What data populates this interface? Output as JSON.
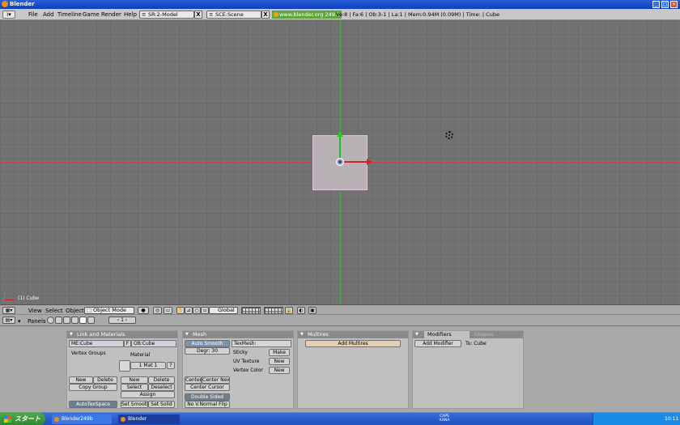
{
  "window": {
    "title": "Blender",
    "controls": [
      "minimize-icon",
      "maximize-icon",
      "close-icon"
    ]
  },
  "info_header": {
    "menus": [
      "File",
      "Add",
      "Timeline",
      "Game",
      "Render",
      "Help"
    ],
    "screen_field": "SR:2-Model",
    "scene_field": "SCE:Scene",
    "close_label": "X",
    "website": "www.blender.org 249.2",
    "stats": "Ve:8 | Fa:6 | Ob:3-1 | La:1  | Mem:0.94M (0.09M)  | Time: | Cube"
  },
  "viewport": {
    "object_label": "(1) Cube"
  },
  "view_header": {
    "menus": [
      "View",
      "Select",
      "Object"
    ],
    "mode": "Object Mode",
    "orientation": "Global"
  },
  "buttons_header": {
    "panels_label": "Panels",
    "frame": "1"
  },
  "panels": {
    "link_materials": {
      "title": "Link and Materials",
      "mesh_name": "ME:Cube",
      "f_label": "F",
      "object_name": "OB:Cube",
      "vertex_groups": "Vertex Groups",
      "material": "Material",
      "mat_index": "1 Mat 1",
      "mat_q": "?",
      "new": "New",
      "delete": "Delete",
      "copy_group": "Copy Group",
      "mat_new": "New",
      "mat_delete": "Delete",
      "select": "Select",
      "deselect": "Deselect",
      "assign": "Assign",
      "autotexspace": "AutoTexSpace",
      "set_smooth": "Set Smooth",
      "set_solid": "Set Solid"
    },
    "mesh": {
      "title": "Mesh",
      "auto_smooth": "Auto Smooth",
      "degr": "Degr: 30",
      "texmesh": "TexMesh:",
      "sticky": "Sticky",
      "make": "Make",
      "uv_texture": "UV Texture",
      "uv_new": "New",
      "vertex_color": "Vertex Color",
      "vc_new": "New",
      "center": "Center",
      "center_new": "Center New",
      "center_cursor": "Center Cursor",
      "double_sided": "Double Sided",
      "no_v_normal_flip": "No V.Normal Flip"
    },
    "multires": {
      "title": "Multires",
      "add_multires": "Add Multires"
    },
    "modifiers": {
      "tab_modifiers": "Modifiers",
      "tab_shapes": "Shapes",
      "add_modifier": "Add Modifier",
      "to_cube": "To: Cube"
    }
  },
  "taskbar": {
    "start": "スタート",
    "tasks": [
      "Blender249b",
      "Blender"
    ],
    "tray_caps": "CAPS",
    "tray_kana": "KANA",
    "clock": "10:11"
  },
  "colors": {
    "viewport_bg": "#727272",
    "panel_bg": "#c0c0c0",
    "accent_link": "#61a63c",
    "xp_blue": "#245edb"
  }
}
